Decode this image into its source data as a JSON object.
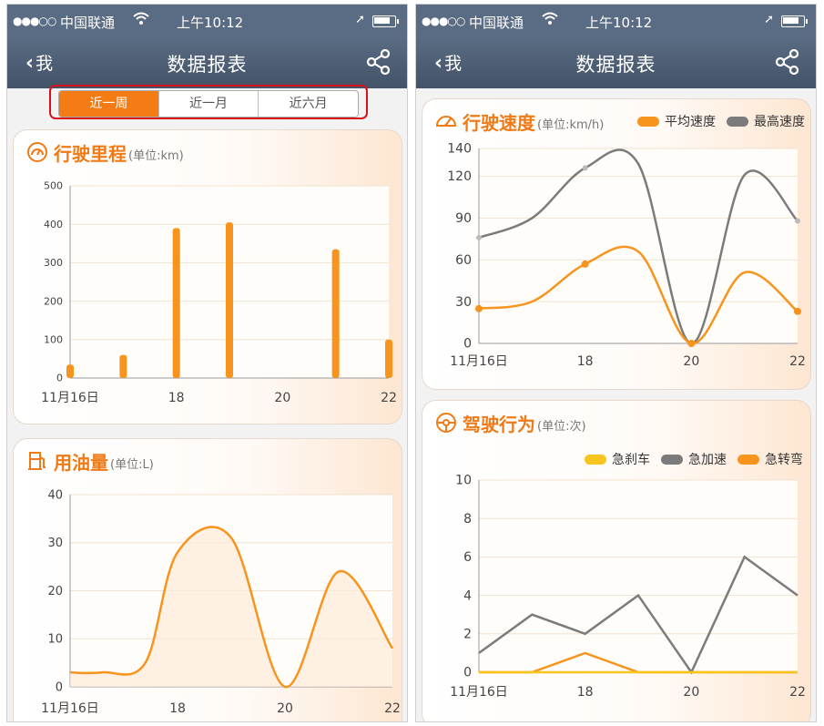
{
  "status_bar": {
    "carrier": "中国联通",
    "time": "上午10:12"
  },
  "nav": {
    "back_label": "我",
    "title": "数据报表"
  },
  "tabs": [
    {
      "label": "近一周",
      "active": true
    },
    {
      "label": "近一月",
      "active": false
    },
    {
      "label": "近六月",
      "active": false
    }
  ],
  "colors": {
    "accent": "#f57c14",
    "orange_line": "#f7941d",
    "gray_line": "#7b7b7b",
    "yellow_line": "#f7c51b",
    "nav": "#4f6077"
  },
  "cards": {
    "mileage": {
      "title": "行驶里程",
      "unit": "(单位:km)",
      "icon": "gauge-icon"
    },
    "fuel": {
      "title": "用油量",
      "unit": "(单位:L)",
      "icon": "fuel-pump-icon"
    },
    "speed": {
      "title": "行驶速度",
      "unit": "(单位:km/h)",
      "icon": "speedometer-icon",
      "legend": [
        "平均速度",
        "最高速度"
      ]
    },
    "behavior": {
      "title": "驾驶行为",
      "unit": "(单位:次)",
      "icon": "steering-wheel-icon",
      "legend": [
        "急刹车",
        "急加速",
        "急转弯"
      ]
    }
  },
  "chart_data": [
    {
      "id": "mileage",
      "type": "bar",
      "x": [
        16,
        17,
        18,
        19,
        20,
        21,
        22
      ],
      "x_tick_labels": [
        "11月16日",
        "18",
        "20",
        "22"
      ],
      "x_tick_values": [
        16,
        18,
        20,
        22
      ],
      "values": [
        35,
        60,
        390,
        405,
        0,
        335,
        100
      ],
      "yticks": [
        0,
        100,
        200,
        300,
        400,
        500
      ],
      "ylim": [
        0,
        500
      ],
      "grid": true
    },
    {
      "id": "fuel",
      "type": "area",
      "x": [
        16,
        16.6,
        17.4,
        18,
        19,
        20,
        21,
        22
      ],
      "values": [
        3,
        3,
        5,
        28,
        31,
        0,
        24,
        8
      ],
      "x_tick_labels": [
        "11月16日",
        "18",
        "20",
        "22"
      ],
      "x_tick_values": [
        16,
        18,
        20,
        22
      ],
      "yticks": [
        0,
        10,
        20,
        30,
        40
      ],
      "ylim": [
        0,
        40
      ],
      "grid": true
    },
    {
      "id": "speed",
      "type": "line",
      "x": [
        16,
        17,
        18,
        19,
        20,
        21,
        22
      ],
      "series": [
        {
          "name": "平均速度",
          "values": [
            25,
            30,
            57,
            66,
            0,
            51,
            23
          ]
        },
        {
          "name": "最高速度",
          "values": [
            76,
            90,
            126,
            129,
            0,
            121,
            88
          ]
        }
      ],
      "x_tick_labels": [
        "11月16日",
        "18",
        "20",
        "22"
      ],
      "x_tick_values": [
        16,
        18,
        20,
        22
      ],
      "yticks": [
        0,
        30,
        60,
        90,
        120,
        140
      ],
      "ylim": [
        0,
        140
      ],
      "grid": true
    },
    {
      "id": "behavior",
      "type": "line",
      "x": [
        16,
        17,
        18,
        19,
        20,
        21,
        22
      ],
      "series": [
        {
          "name": "急刹车",
          "values": [
            0,
            0,
            0,
            0,
            0,
            0,
            0
          ]
        },
        {
          "name": "急加速",
          "values": [
            1,
            3,
            2,
            4,
            0,
            6,
            4
          ]
        },
        {
          "name": "急转弯",
          "values": [
            0,
            0,
            1,
            0,
            0,
            0,
            0
          ]
        }
      ],
      "x_tick_labels": [
        "11月16日",
        "18",
        "20",
        "22"
      ],
      "x_tick_values": [
        16,
        18,
        20,
        22
      ],
      "yticks": [
        0,
        2,
        4,
        6,
        8,
        10
      ],
      "ylim": [
        0,
        10
      ],
      "grid": true
    }
  ]
}
